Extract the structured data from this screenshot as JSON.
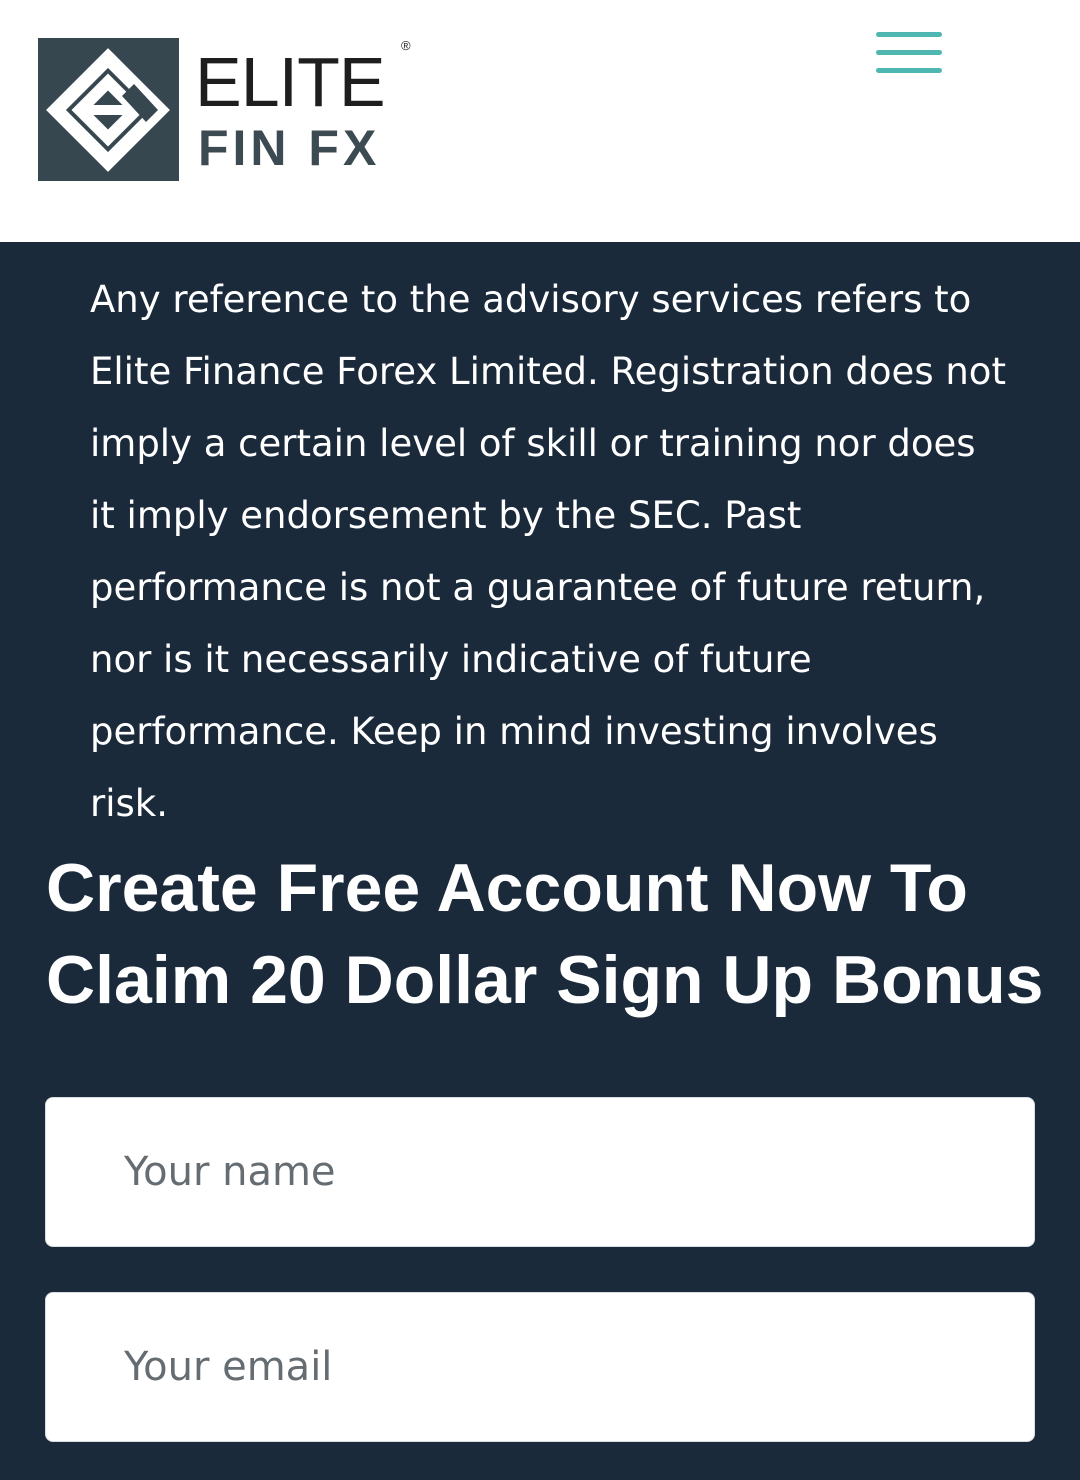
{
  "header": {
    "logo": {
      "line1": "ELITE",
      "registered": "®",
      "line2": "FIN FX"
    },
    "menu_icon": "hamburger-menu-icon"
  },
  "main": {
    "disclaimer": "Any reference to the advisory services refers to Elite Finance Forex Limited. Registration does not imply a certain level of skill or training nor does it imply endorsement by the SEC. Past performance is not a guarantee of future return, nor is it necessarily indicative of future performance. Keep in mind investing involves risk.",
    "headline": {
      "regular": "Create Free Account Now To Claim ",
      "bold": "20 Dollar Sign Up Bonus"
    },
    "form": {
      "name_placeholder": "Your name",
      "email_placeholder": "Your email"
    }
  },
  "colors": {
    "header_bg": "#ffffff",
    "main_bg": "#1b2a3a",
    "logo_mark_bg": "#37474f",
    "menu_accent": "#4fb6b2",
    "text_light": "#ffffff"
  }
}
